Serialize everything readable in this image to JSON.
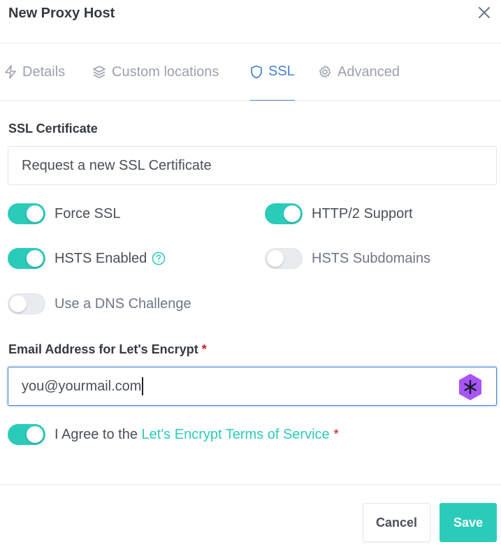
{
  "header": {
    "title": "New Proxy Host"
  },
  "tabs": [
    {
      "label": "Details",
      "icon": "lightning-icon"
    },
    {
      "label": "Custom locations",
      "icon": "layers-icon"
    },
    {
      "label": "SSL",
      "icon": "shield-icon"
    },
    {
      "label": "Advanced",
      "icon": "gear-icon"
    }
  ],
  "active_tab": "SSL",
  "ssl": {
    "certificate_label": "SSL Certificate",
    "certificate_value": "Request a new SSL Certificate",
    "toggles": {
      "force_ssl": {
        "label": "Force SSL",
        "on": true
      },
      "http2": {
        "label": "HTTP/2 Support",
        "on": true
      },
      "hsts_enabled": {
        "label": "HSTS Enabled",
        "on": true
      },
      "hsts_subdomains": {
        "label": "HSTS Subdomains",
        "on": false
      },
      "dns_challenge": {
        "label": "Use a DNS Challenge",
        "on": false
      },
      "agree": {
        "label_prefix": "I Agree to the",
        "link_text": "Let's Encrypt Terms of Service",
        "on": true
      }
    },
    "email_label": "Email Address for Let's Encrypt",
    "email_value": "you@yourmail.com",
    "required_marker": "*"
  },
  "footer": {
    "cancel_label": "Cancel",
    "save_label": "Save"
  },
  "colors": {
    "accent": "#2bcbba",
    "tab_active": "#467fcf",
    "required": "#cd201f",
    "extension": "#a855f7"
  }
}
